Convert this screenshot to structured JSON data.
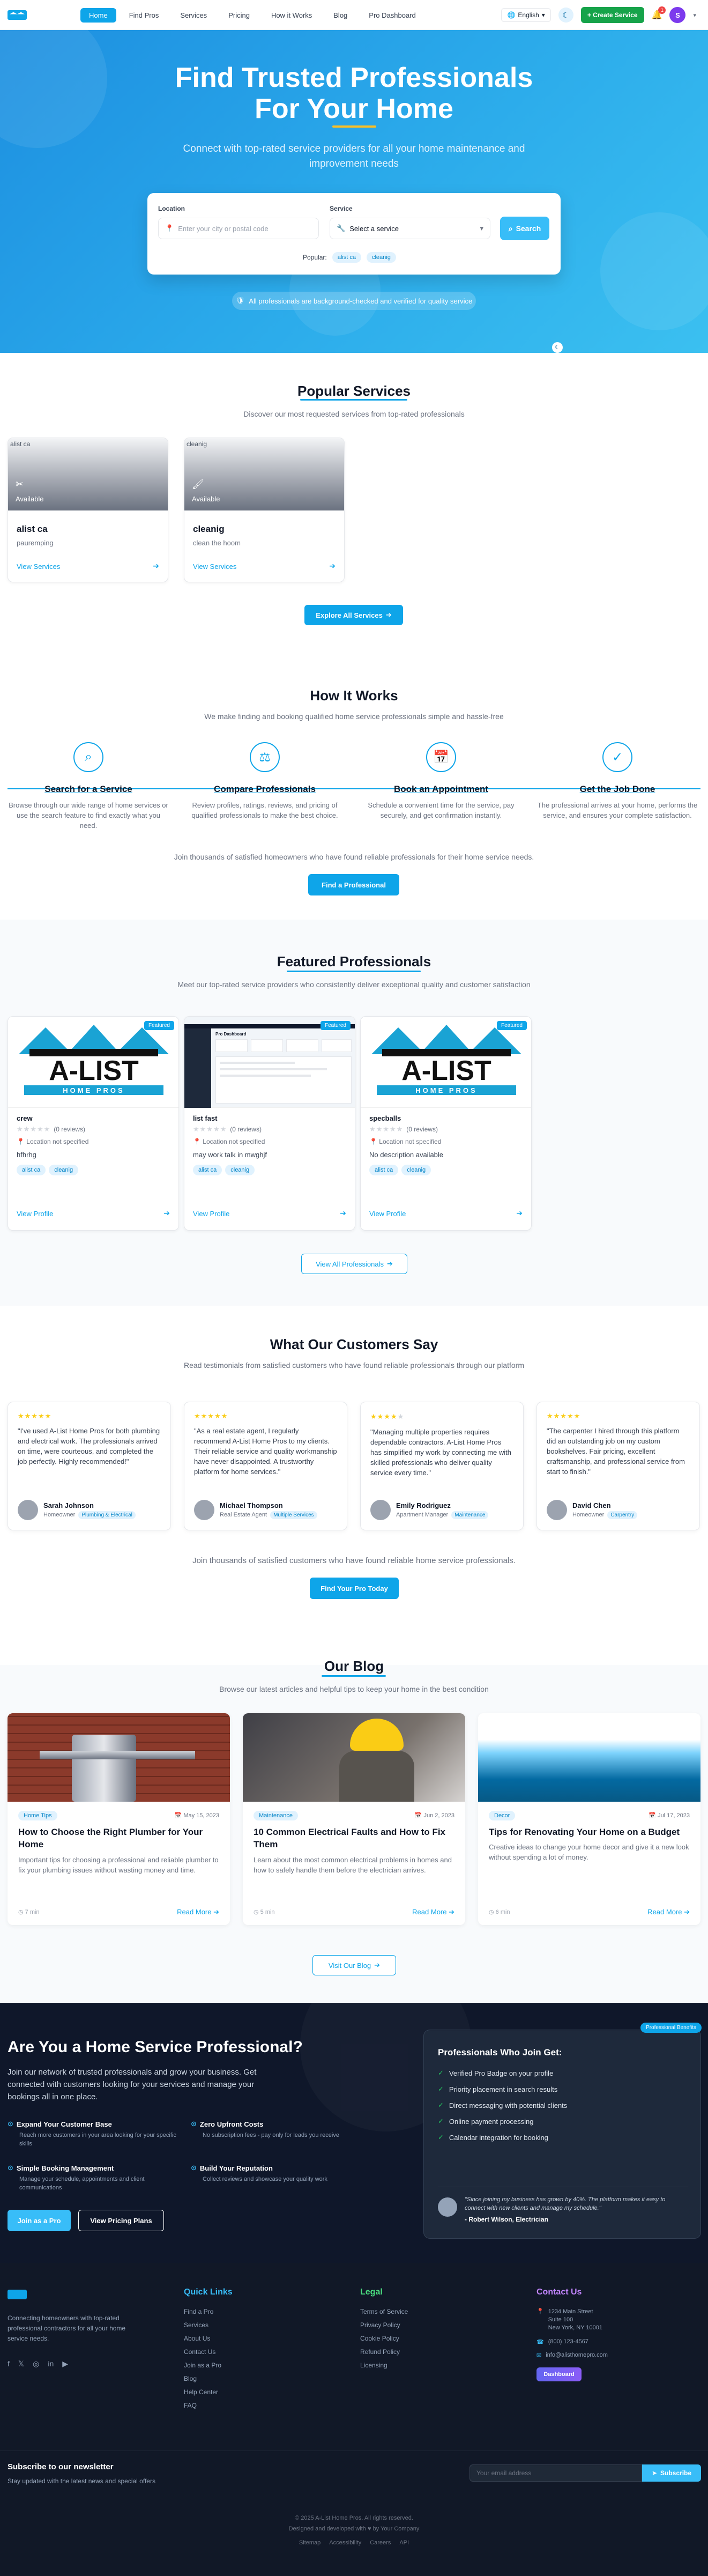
{
  "nav": {
    "links": [
      "Home",
      "Find Pros",
      "Services",
      "Pricing",
      "How it Works",
      "Blog",
      "Pro Dashboard"
    ],
    "language": "English",
    "create_label": "Create Service",
    "notif_count": "1",
    "avatar_initial": "S"
  },
  "hero": {
    "title_line1": "Find Trusted Professionals",
    "title_line2": "For Your Home",
    "subtitle": "Connect with top-rated service providers for all your home maintenance and improvement needs",
    "location_label": "Location",
    "location_placeholder": "Enter your city or postal code",
    "service_label": "Service",
    "service_value": "Select a service",
    "search_label": "Search",
    "popular_label": "Popular:",
    "popular_tags": [
      "alist ca",
      "cleanig"
    ],
    "verified_text": "All professionals are background-checked and verified for quality service"
  },
  "services": {
    "title": "Popular Services",
    "subtitle": "Discover our most requested services from top-rated professionals",
    "items": [
      {
        "img_alt": "alist ca",
        "availability": "Available",
        "name": "alist ca",
        "desc": "pauremping",
        "link": "View Services"
      },
      {
        "img_alt": "cleanig",
        "availability": "Available",
        "name": "cleanig",
        "desc": "clean the hoom",
        "link": "View Services"
      }
    ],
    "explore_label": "Explore All Services"
  },
  "how": {
    "title": "How It Works",
    "subtitle": "We make finding and booking qualified home service professionals simple and hassle-free",
    "steps": [
      {
        "title": "Search for a Service",
        "desc": "Browse through our wide range of home services or use the search feature to find exactly what you need."
      },
      {
        "title": "Compare Professionals",
        "desc": "Review profiles, ratings, reviews, and pricing of qualified professionals to make the best choice."
      },
      {
        "title": "Book an Appointment",
        "desc": "Schedule a convenient time for the service, pay securely, and get confirmation instantly."
      },
      {
        "title": "Get the Job Done",
        "desc": "The professional arrives at your home, performs the service, and ensures your complete satisfaction."
      }
    ],
    "join_text": "Join thousands of satisfied homeowners who have found reliable professionals for their home service needs.",
    "find_label": "Find a Professional"
  },
  "featured": {
    "title": "Featured Professionals",
    "subtitle": "Meet our top-rated service providers who consistently deliver exceptional quality and customer satisfaction",
    "badge": "Featured",
    "logo_text": "A-LIST",
    "logo_sub": "HOME PROS",
    "pros": [
      {
        "name": "crew",
        "reviews": "(0 reviews)",
        "location": "Location not specified",
        "desc": "hfhrhg",
        "tags": [
          "alist ca",
          "cleanig"
        ],
        "link": "View Profile"
      },
      {
        "name": "list fast",
        "reviews": "(0 reviews)",
        "location": "Location not specified",
        "desc": "may work talk in mwghjf",
        "tags": [
          "alist ca",
          "cleanig"
        ],
        "link": "View Profile"
      },
      {
        "name": "specballs",
        "reviews": "(0 reviews)",
        "location": "Location not specified",
        "desc": "No description available",
        "tags": [
          "alist ca",
          "cleanig"
        ],
        "link": "View Profile"
      }
    ],
    "view_all_label": "View All Professionals",
    "dash_title": "Pro Dashboard"
  },
  "testimonials": {
    "title": "What Our Customers Say",
    "subtitle": "Read testimonials from satisfied customers who have found reliable professionals through our platform",
    "items": [
      {
        "stars": 5,
        "quote": "\"I've used A-List Home Pros for both plumbing and electrical work. The professionals arrived on time, were courteous, and completed the job perfectly. Highly recommended!\"",
        "name": "Sarah Johnson",
        "role": "Homeowner",
        "tag": "Plumbing & Electrical"
      },
      {
        "stars": 5,
        "quote": "\"As a real estate agent, I regularly recommend A-List Home Pros to my clients. Their reliable service and quality workmanship have never disappointed. A trustworthy platform for home services.\"",
        "name": "Michael Thompson",
        "role": "Real Estate Agent",
        "tag": "Multiple Services"
      },
      {
        "stars": 4,
        "quote": "\"Managing multiple properties requires dependable contractors. A-List Home Pros has simplified my work by connecting me with skilled professionals who deliver quality service every time.\"",
        "name": "Emily Rodriguez",
        "role": "Apartment Manager",
        "tag": "Maintenance"
      },
      {
        "stars": 5,
        "quote": "\"The carpenter I hired through this platform did an outstanding job on my custom bookshelves. Fair pricing, excellent craftsmanship, and professional service from start to finish.\"",
        "name": "David Chen",
        "role": "Homeowner",
        "tag": "Carpentry"
      }
    ],
    "join_text": "Join thousands of satisfied customers who have found reliable home service professionals.",
    "cta_label": "Find Your Pro Today"
  },
  "blog": {
    "title": "Our Blog",
    "subtitle": "Browse our latest articles and helpful tips to keep your home in the best condition",
    "posts": [
      {
        "category": "Home Tips",
        "date": "May 15, 2023",
        "title": "How to Choose the Right Plumber for Your Home",
        "excerpt": "Important tips for choosing a professional and reliable plumber to fix your plumbing issues without wasting money and time.",
        "read": "7 min",
        "more": "Read More"
      },
      {
        "category": "Maintenance",
        "date": "Jun 2, 2023",
        "title": "10 Common Electrical Faults and How to Fix Them",
        "excerpt": "Learn about the most common electrical problems in homes and how to safely handle them before the electrician arrives.",
        "read": "5 min",
        "more": "Read More"
      },
      {
        "category": "Decor",
        "date": "Jul 17, 2023",
        "title": "Tips for Renovating Your Home on a Budget",
        "excerpt": "Creative ideas to change your home decor and give it a new look without spending a lot of money.",
        "read": "6 min",
        "more": "Read More"
      }
    ],
    "visit_label": "Visit Our Blog"
  },
  "pro_cta": {
    "title": "Are You a Home Service Professional?",
    "lead": "Join our network of trusted professionals and grow your business. Get connected with customers looking for your services and manage your bookings all in one place.",
    "features": [
      {
        "title": "Expand Your Customer Base",
        "desc": "Reach more customers in your area looking for your specific skills"
      },
      {
        "title": "Zero Upfront Costs",
        "desc": "No subscription fees - pay only for leads you receive"
      },
      {
        "title": "Simple Booking Management",
        "desc": "Manage your schedule, appointments and client communications"
      },
      {
        "title": "Build Your Reputation",
        "desc": "Collect reviews and showcase your quality work"
      }
    ],
    "join_label": "Join as a Pro",
    "pricing_label": "View Pricing Plans",
    "panel_badge": "Professional Benefits",
    "panel_title": "Professionals Who Join Get:",
    "benefits": [
      "Verified Pro Badge on your profile",
      "Priority placement in search results",
      "Direct messaging with potential clients",
      "Online payment processing",
      "Calendar integration for booking"
    ],
    "quote": "\"Since joining my business has grown by 40%. The platform makes it easy to connect with new clients and manage my schedule.\"",
    "quote_author": "- Robert Wilson, Electrician"
  },
  "footer": {
    "tagline": "Connecting homeowners with top-rated professional contractors for all your home service needs.",
    "quick_title": "Quick Links",
    "quick_links": [
      "Find a Pro",
      "Services",
      "About Us",
      "Contact Us",
      "Join as a Pro",
      "Blog",
      "Help Center",
      "FAQ"
    ],
    "legal_title": "Legal",
    "legal_links": [
      "Terms of Service",
      "Privacy Policy",
      "Cookie Policy",
      "Refund Policy",
      "Licensing"
    ],
    "contact_title": "Contact Us",
    "address_1": "1234 Main Street",
    "address_2": "Suite 100",
    "address_3": "New York, NY 10001",
    "phone": "(800) 123-4567",
    "email": "info@alisthomepro.com",
    "dashboard_label": "Dashboard",
    "newsletter_title": "Subscribe to our newsletter",
    "newsletter_sub": "Stay updated with the latest news and special offers",
    "email_placeholder": "Your email address",
    "subscribe_label": "Subscribe",
    "copyright": "© 2025 A-List Home Pros. All rights reserved.",
    "credit": "Designed and developed with ♥ by Your Company",
    "bottom_links": [
      "Sitemap",
      "Accessibility",
      "Careers",
      "API"
    ]
  },
  "colors": {
    "accent": "#0ea5e9",
    "create": "#16a34a",
    "dark": "#0f172a",
    "star": "#facc15"
  }
}
